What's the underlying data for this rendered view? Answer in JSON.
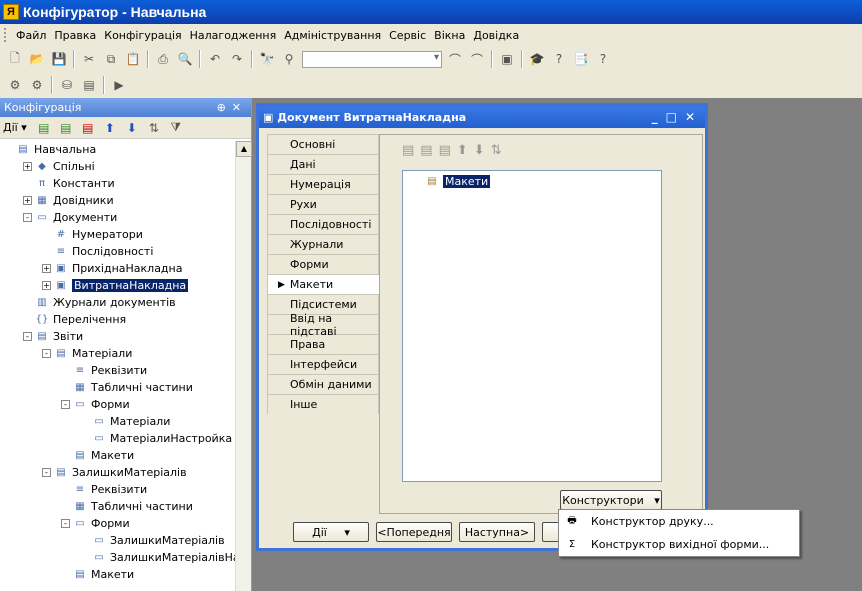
{
  "window": {
    "title": "Конфігуратор - Навчальна"
  },
  "menu": [
    "Файл",
    "Правка",
    "Конфігурація",
    "Налагодження",
    "Адміністрування",
    "Сервіс",
    "Вікна",
    "Довідка"
  ],
  "config_panel": {
    "title": "Конфігурація",
    "actions_label": "Дії",
    "tree": [
      {
        "label": "Навчальна",
        "level": 0,
        "icon": "config-icon",
        "pm": ""
      },
      {
        "label": "Спільні",
        "level": 1,
        "icon": "shapes-icon",
        "pm": "+"
      },
      {
        "label": "Константи",
        "level": 1,
        "icon": "constants-icon",
        "pm": ""
      },
      {
        "label": "Довідники",
        "level": 1,
        "icon": "catalogs-icon",
        "pm": "+"
      },
      {
        "label": "Документи",
        "level": 1,
        "icon": "folder-icon",
        "pm": "-"
      },
      {
        "label": "Нумератори",
        "level": 2,
        "icon": "numerator-icon",
        "pm": ""
      },
      {
        "label": "Послідовності",
        "level": 2,
        "icon": "sequence-icon",
        "pm": ""
      },
      {
        "label": "ПрихіднаНакладна",
        "level": 2,
        "icon": "document-icon",
        "pm": "+"
      },
      {
        "label": "ВитратнаНакладна",
        "level": 2,
        "icon": "document-icon",
        "pm": "+",
        "selected": true
      },
      {
        "label": "Журнали документів",
        "level": 1,
        "icon": "journal-icon",
        "pm": ""
      },
      {
        "label": "Перелічення",
        "level": 1,
        "icon": "enum-icon",
        "pm": ""
      },
      {
        "label": "Звіти",
        "level": 1,
        "icon": "report-icon",
        "pm": "-"
      },
      {
        "label": "Матеріали",
        "level": 2,
        "icon": "report-icon",
        "pm": "-"
      },
      {
        "label": "Реквізити",
        "level": 3,
        "icon": "attributes-icon",
        "pm": ""
      },
      {
        "label": "Табличні частини",
        "level": 3,
        "icon": "table-icon",
        "pm": ""
      },
      {
        "label": "Форми",
        "level": 3,
        "icon": "form-icon",
        "pm": "-"
      },
      {
        "label": "Матеріали",
        "level": 4,
        "icon": "form-icon",
        "pm": ""
      },
      {
        "label": "МатеріалиНастройка",
        "level": 4,
        "icon": "form-icon",
        "pm": ""
      },
      {
        "label": "Макети",
        "level": 3,
        "icon": "template-icon",
        "pm": ""
      },
      {
        "label": "ЗалишкиМатеріалів",
        "level": 2,
        "icon": "report-icon",
        "pm": "-"
      },
      {
        "label": "Реквізити",
        "level": 3,
        "icon": "attributes-icon",
        "pm": ""
      },
      {
        "label": "Табличні частини",
        "level": 3,
        "icon": "table-icon",
        "pm": ""
      },
      {
        "label": "Форми",
        "level": 3,
        "icon": "form-icon",
        "pm": "-"
      },
      {
        "label": "ЗалишкиМатеріалів",
        "level": 4,
        "icon": "form-icon",
        "pm": ""
      },
      {
        "label": "ЗалишкиМатеріалівНастро",
        "level": 4,
        "icon": "form-icon",
        "pm": ""
      },
      {
        "label": "Макети",
        "level": 3,
        "icon": "template-icon",
        "pm": ""
      }
    ]
  },
  "doc_window": {
    "title": "Документ ВитратнаНакладна",
    "tabs": [
      "Основні",
      "Дані",
      "Нумерація",
      "Рухи",
      "Послідовності",
      "Журнали",
      "Форми",
      "Макети",
      "Підсистеми",
      "Ввід на підставі",
      "Права",
      "Інтерфейси",
      "Обмін даними",
      "Інше"
    ],
    "active_tab": "Макети",
    "list_items": [
      "Макети"
    ],
    "constructors_button": "Конструктори",
    "actions_button": "Дії",
    "prev_button": "<Попередня",
    "next_button": "Наступна>"
  },
  "constructors_menu": [
    "Конструктор друку...",
    "Конструктор вихідної форми..."
  ]
}
